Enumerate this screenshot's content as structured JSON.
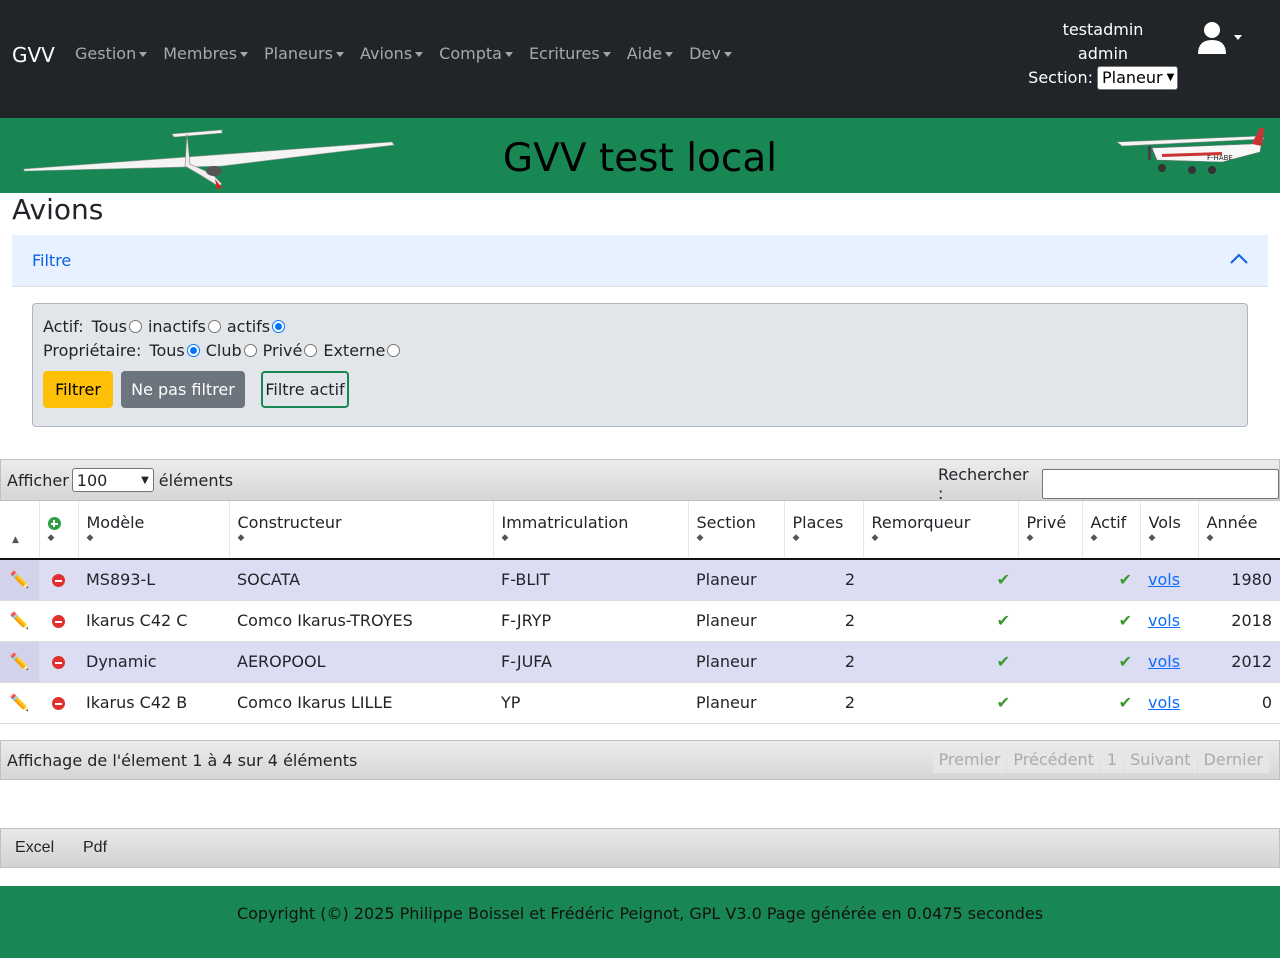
{
  "nav": {
    "brand": "GVV",
    "menu": [
      {
        "label": "Gestion"
      },
      {
        "label": "Membres"
      },
      {
        "label": "Planeurs"
      },
      {
        "label": "Avions"
      },
      {
        "label": "Compta"
      },
      {
        "label": "Ecritures"
      },
      {
        "label": "Aide"
      },
      {
        "label": "Dev"
      }
    ],
    "user": {
      "name": "testadmin",
      "role": "admin",
      "section_label": "Section:",
      "section_value": "Planeur"
    }
  },
  "banner": {
    "title": "GVV test local",
    "plane_registration": "F-HABE"
  },
  "page": {
    "title": "Avions"
  },
  "filter": {
    "accordion_label": "Filtre",
    "actif_label": "Actif:",
    "actif_options": [
      {
        "label": "Tous",
        "checked": false
      },
      {
        "label": "inactifs",
        "checked": false
      },
      {
        "label": "actifs",
        "checked": true
      }
    ],
    "owner_label": "Propriétaire:",
    "owner_options": [
      {
        "label": "Tous",
        "checked": true
      },
      {
        "label": "Club",
        "checked": false
      },
      {
        "label": "Privé",
        "checked": false
      },
      {
        "label": "Externe",
        "checked": false
      }
    ],
    "btn_filter": "Filtrer",
    "btn_nofilter": "Ne pas filtrer",
    "btn_active": "Filtre actif"
  },
  "table": {
    "show_label": "Afficher",
    "page_length": "100",
    "show_suffix": "éléments",
    "search_label": "Rechercher :",
    "columns": [
      "Modèle",
      "Constructeur",
      "Immatriculation",
      "Section",
      "Places",
      "Remorqueur",
      "Privé",
      "Actif",
      "Vols",
      "Année"
    ],
    "rows": [
      {
        "modele": "MS893-L",
        "constructeur": "SOCATA",
        "immat": "F-BLIT",
        "section": "Planeur",
        "places": "2",
        "remorqueur": true,
        "prive": false,
        "actif": true,
        "vols": "vols",
        "annee": "1980"
      },
      {
        "modele": "Ikarus C42 C",
        "constructeur": "Comco Ikarus-TROYES",
        "immat": "F-JRYP",
        "section": "Planeur",
        "places": "2",
        "remorqueur": true,
        "prive": false,
        "actif": true,
        "vols": "vols",
        "annee": "2018"
      },
      {
        "modele": "Dynamic",
        "constructeur": "AEROPOOL",
        "immat": "F-JUFA",
        "section": "Planeur",
        "places": "2",
        "remorqueur": true,
        "prive": false,
        "actif": true,
        "vols": "vols",
        "annee": "2012"
      },
      {
        "modele": "Ikarus C42 B",
        "constructeur": "Comco Ikarus LILLE",
        "immat": "YP",
        "section": "Planeur",
        "places": "2",
        "remorqueur": true,
        "prive": false,
        "actif": true,
        "vols": "vols",
        "annee": "0"
      }
    ],
    "info": "Affichage de l'élement 1 à 4 sur 4 éléments",
    "pager": [
      "Premier",
      "Précédent",
      "1",
      "Suivant",
      "Dernier"
    ]
  },
  "export": {
    "excel": "Excel",
    "pdf": "Pdf"
  },
  "footer": {
    "copyright": "Copyright (©) 2025 Philippe Boissel et Frédéric Peignot, GPL V3.0 Page générée en 0.0475 secondes"
  },
  "colors": {
    "navbar": "#212529",
    "banner": "#198754",
    "accent_yellow": "#ffc107",
    "link": "#0d6efd"
  }
}
